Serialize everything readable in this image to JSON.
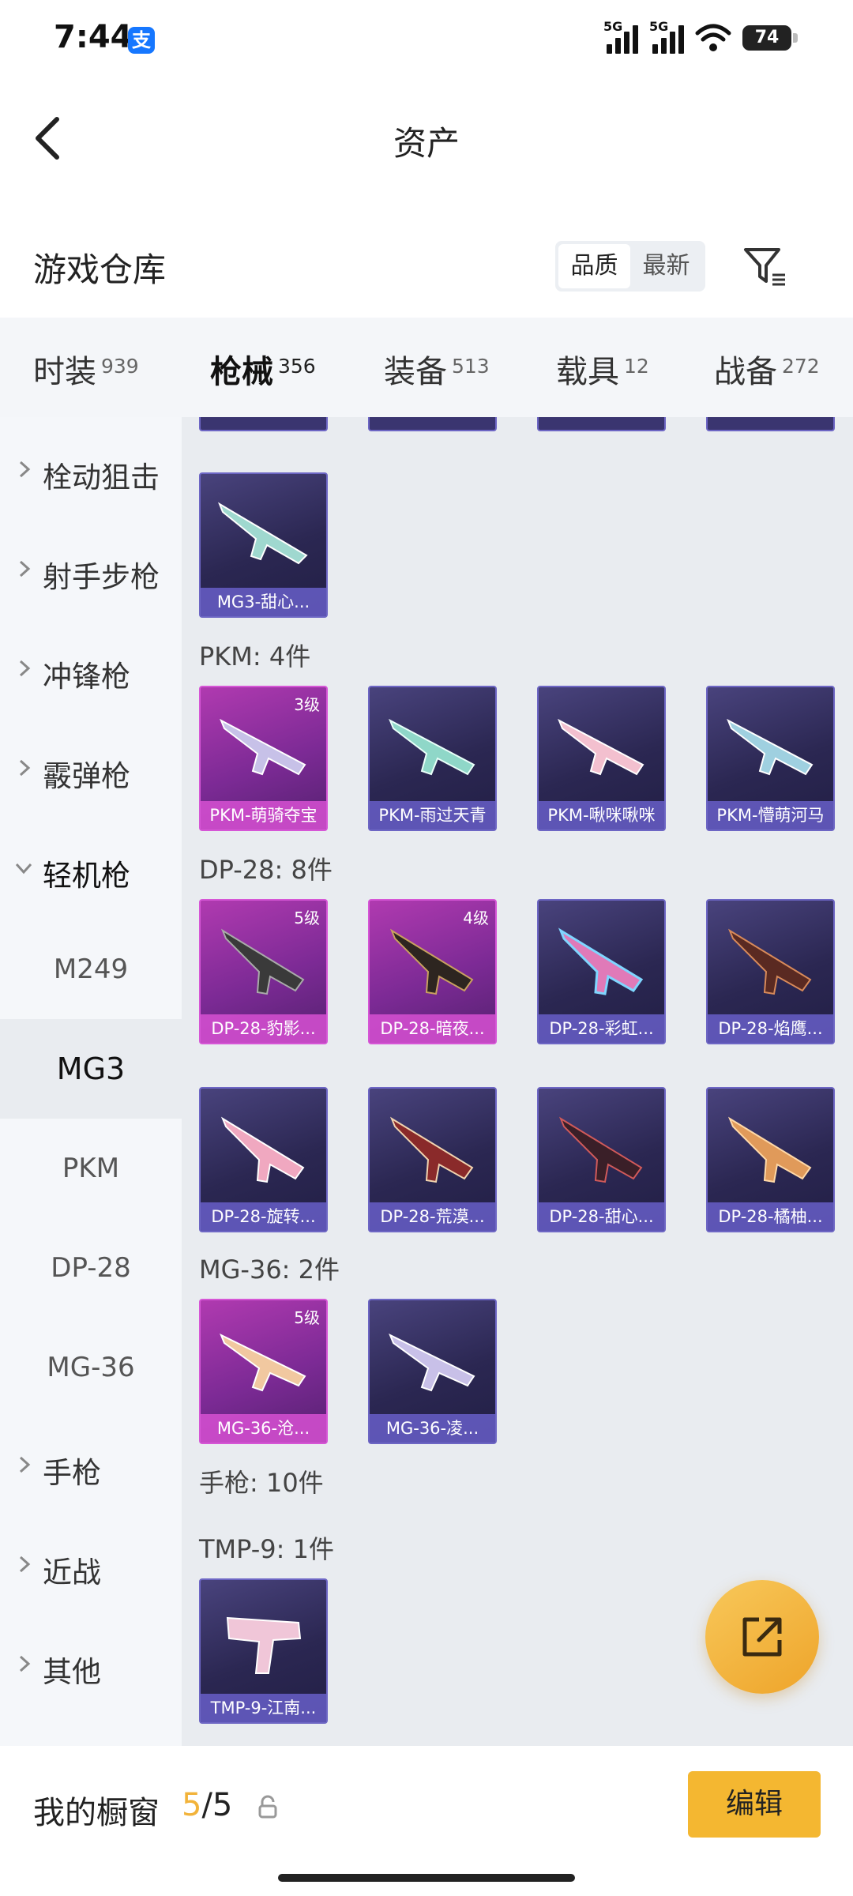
{
  "status": {
    "time": "7:44",
    "alipay_glyph": "支",
    "net1": "5G",
    "net2": "5G",
    "battery": "74"
  },
  "header": {
    "title": "资产"
  },
  "warehouse": {
    "title": "游戏仓库",
    "sort_quality": "品质",
    "sort_newest": "最新"
  },
  "tabs": [
    {
      "label": "时装",
      "count": "939"
    },
    {
      "label": "枪械",
      "count": "356"
    },
    {
      "label": "装备",
      "count": "513"
    },
    {
      "label": "载具",
      "count": "12"
    },
    {
      "label": "战备",
      "count": "272"
    }
  ],
  "sidebar": {
    "items": [
      {
        "label": "栓动狙击"
      },
      {
        "label": "射手步枪"
      },
      {
        "label": "冲锋枪"
      },
      {
        "label": "霰弹枪"
      },
      {
        "label": "轻机枪"
      }
    ],
    "subitems": [
      {
        "label": "M249"
      },
      {
        "label": "MG3"
      },
      {
        "label": "PKM"
      },
      {
        "label": "DP-28"
      },
      {
        "label": "MG-36"
      }
    ],
    "items_after": [
      {
        "label": "手枪"
      },
      {
        "label": "近战"
      },
      {
        "label": "其他"
      }
    ]
  },
  "groups": {
    "mg3": {
      "cards": [
        {
          "name": "MG3-甜心..."
        }
      ]
    },
    "pkm": {
      "label": "PKM: 4件",
      "cards": [
        {
          "name": "PKM-萌骑夺宝",
          "level": "3级"
        },
        {
          "name": "PKM-雨过天青"
        },
        {
          "name": "PKM-啾咪啾咪"
        },
        {
          "name": "PKM-懵萌河马"
        }
      ]
    },
    "dp28": {
      "label": "DP-28: 8件",
      "cards": [
        {
          "name": "DP-28-豹影...",
          "level": "5级"
        },
        {
          "name": "DP-28-暗夜...",
          "level": "4级"
        },
        {
          "name": "DP-28-彩虹..."
        },
        {
          "name": "DP-28-焰鹰..."
        },
        {
          "name": "DP-28-旋转..."
        },
        {
          "name": "DP-28-荒漠..."
        },
        {
          "name": "DP-28-甜心..."
        },
        {
          "name": "DP-28-橘柚..."
        }
      ]
    },
    "mg36": {
      "label": "MG-36: 2件",
      "cards": [
        {
          "name": "MG-36-沧...",
          "level": "5级"
        },
        {
          "name": "MG-36-凌..."
        }
      ]
    },
    "pistol": {
      "label": "手枪: 10件"
    },
    "tmp9": {
      "label": "TMP-9: 1件",
      "cards": [
        {
          "name": "TMP-9-江南..."
        }
      ]
    }
  },
  "bottom": {
    "label": "我的橱窗",
    "count_current": "5",
    "count_total": "/5",
    "edit_label": "编辑"
  },
  "colors": {
    "accent": "#f4b731",
    "tab_indicator": "#f5b72e",
    "card_purple": "#2b2752",
    "card_pink": "#9a33a6"
  }
}
